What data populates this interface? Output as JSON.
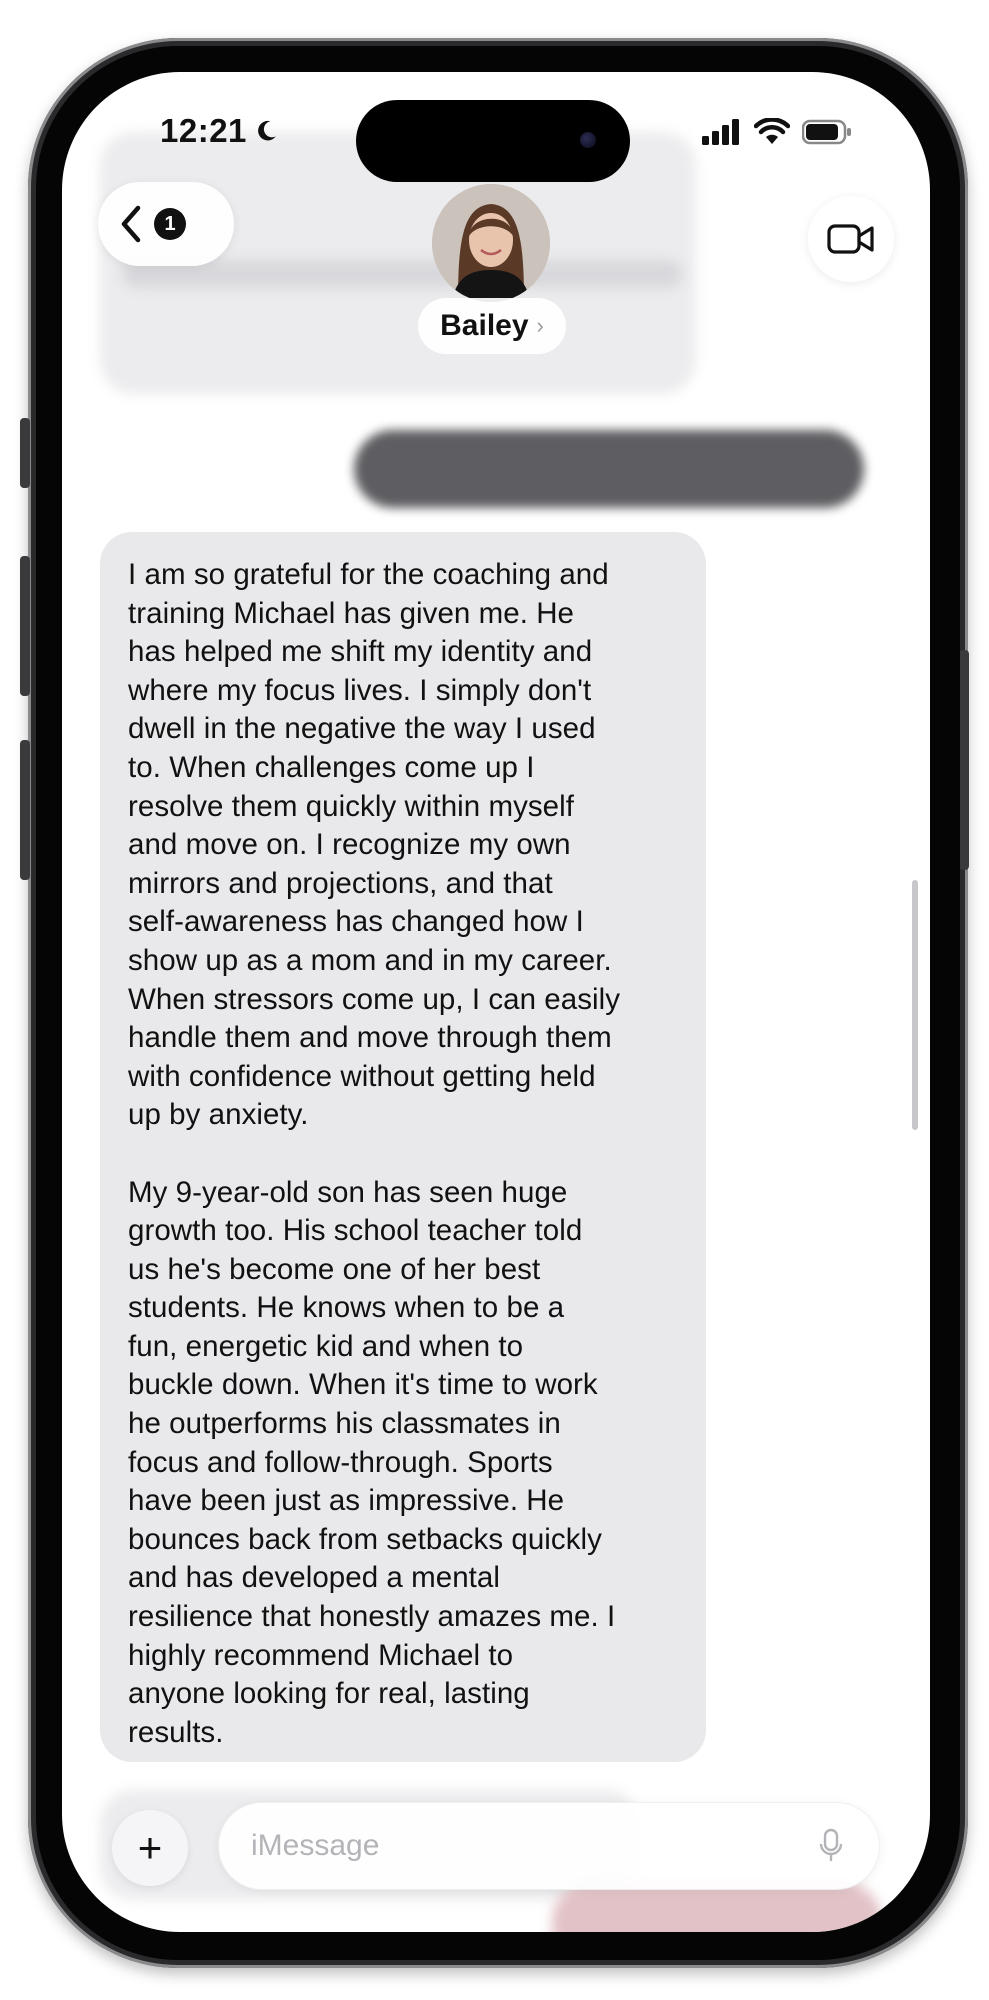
{
  "status_bar": {
    "time": "12:21"
  },
  "header": {
    "back_count": "1",
    "contact_name": "Bailey"
  },
  "message": {
    "text": "I am so grateful for the coaching and\ntraining Michael has given me. He\nhas helped me shift my identity and\nwhere my focus lives. I simply don't\ndwell in the negative the way I used\nto. When challenges come up I\nresolve them quickly within myself\nand move on. I recognize my own\nmirrors and projections, and that\nself-awareness has changed how I\nshow up as a mom and in my career.\nWhen stressors come up, I can easily\nhandle them and move through them\nwith confidence without getting held\nup by anxiety.\n\nMy 9-year-old son has seen huge\ngrowth too. His school teacher told\nus he's become one of her best\nstudents. He knows when to be a\nfun, energetic kid and when to\nbuckle down. When it's time to work\nhe outperforms his classmates in\nfocus and follow-through. Sports\nhave been just as impressive. He\nbounces back from setbacks quickly\nand has developed a mental\nresilience that honestly amazes me. I\nhighly recommend Michael to\nanyone looking for real, lasting\nresults."
  },
  "input": {
    "placeholder": "iMessage"
  },
  "colors": {
    "received_bubble": "#e9e9eb",
    "sent_bubble_blurred": "#5e5e62"
  },
  "icons": [
    "moon-icon",
    "signal-icon",
    "wifi-icon",
    "battery-icon",
    "back-chevron-icon",
    "video-camera-icon",
    "plus-icon",
    "microphone-icon"
  ]
}
